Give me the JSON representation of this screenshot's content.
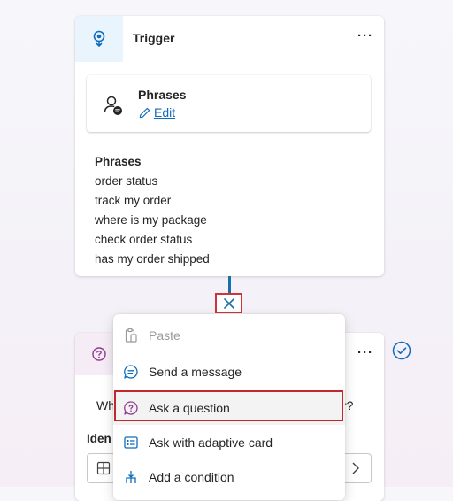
{
  "trigger": {
    "title": "Trigger",
    "more": "···",
    "phrases_box": {
      "title": "Phrases",
      "edit": "Edit"
    },
    "phrase_list": {
      "heading": "Phrases",
      "items": [
        "order status",
        "track my order",
        "where is my package",
        "check order status",
        "has my order shipped"
      ]
    }
  },
  "question_card": {
    "more": "···",
    "text_start": "Wh",
    "text_end": "r?",
    "identify_label": "Iden"
  },
  "menu": {
    "items": [
      {
        "label": "Paste",
        "icon": "paste-icon",
        "disabled": true
      },
      {
        "label": "Send a message",
        "icon": "message-icon"
      },
      {
        "label": "Ask a question",
        "icon": "question-icon",
        "selected": true
      },
      {
        "label": "Ask with adaptive card",
        "icon": "adaptive-card-icon"
      },
      {
        "label": "Add a condition",
        "icon": "condition-icon"
      }
    ]
  },
  "colors": {
    "accent": "#0f6cbd",
    "highlight": "#c4262e",
    "connector": "#1b6fa8"
  }
}
